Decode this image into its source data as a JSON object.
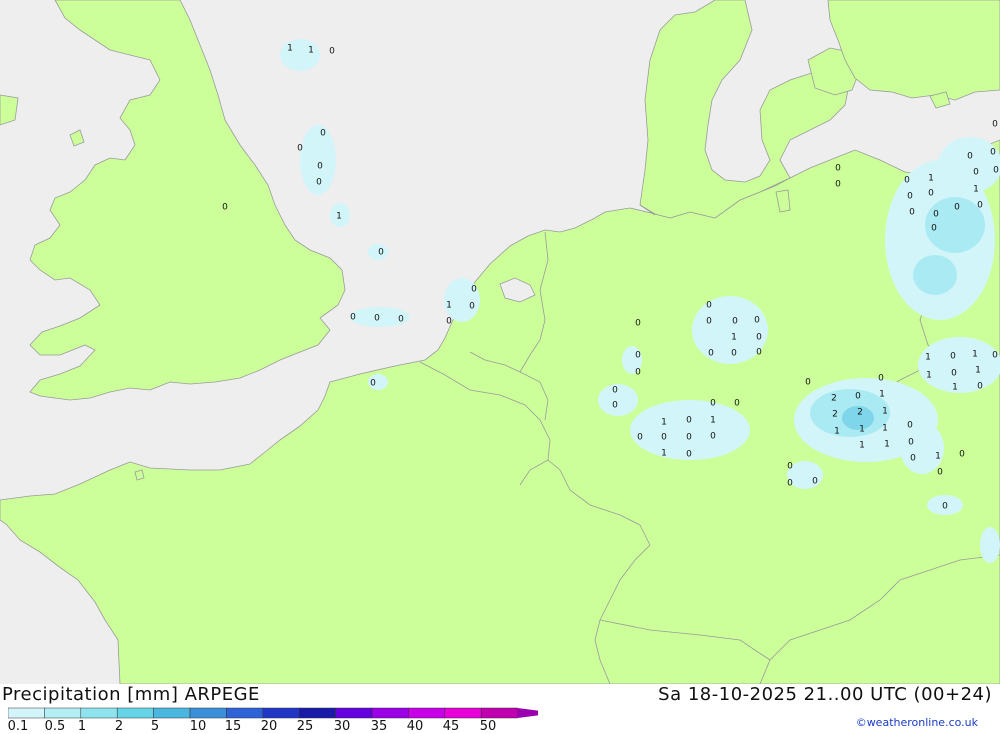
{
  "title_left": "Precipitation [mm] ARPEGE",
  "title_right": "Sa 18-10-2025 21..00 UTC (00+24)",
  "credit": "©weatheronline.co.uk",
  "colors": {
    "sea": "#eeeeee",
    "land": "#ccff99",
    "border": "#9a9a9a",
    "precip_light": "#d2f5fa",
    "precip_mid": "#aaeaf2",
    "precip_heavy": "#7fd6ea"
  },
  "legend": {
    "labels": [
      "0.1",
      "0.5",
      "1",
      "2",
      "5",
      "10",
      "15",
      "20",
      "25",
      "30",
      "35",
      "40",
      "45",
      "50"
    ],
    "colors": [
      "#d2f5fa",
      "#b3eef5",
      "#8de4ee",
      "#64d4e6",
      "#4ab7e0",
      "#3a8fdb",
      "#2e63d8",
      "#2236c6",
      "#1a1aa8",
      "#6400e0",
      "#9b00e6",
      "#c800e8",
      "#e800d8",
      "#c000b0"
    ]
  },
  "map_labels": [
    {
      "text": "1"
    },
    {
      "text": "1"
    },
    {
      "text": "0"
    },
    {
      "text": "0"
    },
    {
      "text": "0"
    },
    {
      "text": "0"
    },
    {
      "text": "0"
    },
    {
      "text": "0"
    },
    {
      "text": "1"
    },
    {
      "text": "0"
    },
    {
      "text": "0"
    },
    {
      "text": "0"
    },
    {
      "text": "0"
    },
    {
      "text": "0"
    },
    {
      "text": "1"
    },
    {
      "text": "0"
    },
    {
      "text": "0"
    },
    {
      "text": "0"
    },
    {
      "text": "0"
    },
    {
      "text": "0"
    },
    {
      "text": "0"
    },
    {
      "text": "0"
    },
    {
      "text": "0"
    },
    {
      "text": "1"
    },
    {
      "text": "0"
    },
    {
      "text": "0"
    },
    {
      "text": "0"
    },
    {
      "text": "0"
    },
    {
      "text": "0"
    },
    {
      "text": "0"
    },
    {
      "text": "0"
    },
    {
      "text": "0"
    },
    {
      "text": "1"
    },
    {
      "text": "0"
    },
    {
      "text": "0"
    },
    {
      "text": "0"
    },
    {
      "text": "1"
    },
    {
      "text": "0"
    },
    {
      "text": "0"
    },
    {
      "text": "0"
    },
    {
      "text": "0"
    },
    {
      "text": "1"
    },
    {
      "text": "0"
    },
    {
      "text": "0"
    },
    {
      "text": "2"
    },
    {
      "text": "0"
    },
    {
      "text": "1"
    },
    {
      "text": "0"
    },
    {
      "text": "2"
    },
    {
      "text": "2"
    },
    {
      "text": "1"
    },
    {
      "text": "1"
    },
    {
      "text": "1"
    },
    {
      "text": "1"
    },
    {
      "text": "1"
    },
    {
      "text": "1"
    },
    {
      "text": "0"
    },
    {
      "text": "0"
    },
    {
      "text": "1"
    },
    {
      "text": "0"
    },
    {
      "text": "0"
    },
    {
      "text": "0"
    },
    {
      "text": "0"
    },
    {
      "text": "0"
    },
    {
      "text": "0"
    },
    {
      "text": "0"
    },
    {
      "text": "1"
    },
    {
      "text": "0"
    },
    {
      "text": "1"
    },
    {
      "text": "0"
    },
    {
      "text": "1"
    },
    {
      "text": "1"
    },
    {
      "text": "1"
    },
    {
      "text": "0"
    },
    {
      "text": "0"
    },
    {
      "text": "0"
    },
    {
      "text": "0"
    },
    {
      "text": "0"
    },
    {
      "text": "0"
    },
    {
      "text": "0"
    },
    {
      "text": "1"
    },
    {
      "text": "0"
    },
    {
      "text": "0"
    },
    {
      "text": "0"
    },
    {
      "text": "1"
    },
    {
      "text": "0"
    },
    {
      "text": "0"
    },
    {
      "text": "0"
    },
    {
      "text": "0"
    },
    {
      "text": "0"
    },
    {
      "text": "0"
    },
    {
      "text": "0"
    },
    {
      "text": "0"
    }
  ]
}
